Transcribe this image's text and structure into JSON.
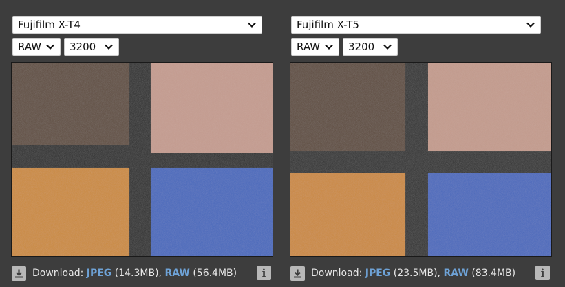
{
  "left": {
    "camera": "Fujifilm X-T4",
    "format": "RAW",
    "iso": "3200",
    "download_label": "Download:",
    "jpeg_label": "JPEG",
    "jpeg_size": "(14.3MB),",
    "raw_label": "RAW",
    "raw_size": "(56.4MB)"
  },
  "right": {
    "camera": "Fujifilm X-T5",
    "format": "RAW",
    "iso": "3200",
    "download_label": "Download:",
    "jpeg_label": "JPEG",
    "jpeg_size": "(23.5MB),",
    "raw_label": "RAW",
    "raw_size": "(83.4MB)"
  },
  "colors": {
    "background": "#3d3d3d",
    "link": "#6ea2d6",
    "patch_brown": "#5e4a3c",
    "patch_pink": "#c59b8e",
    "patch_orange": "#cc8a3a",
    "patch_blue": "#4467bd",
    "grid_dark": "#242424"
  },
  "icons": {
    "download": "download-icon",
    "info": "info-icon",
    "dropdown": "chevron-down-icon"
  }
}
